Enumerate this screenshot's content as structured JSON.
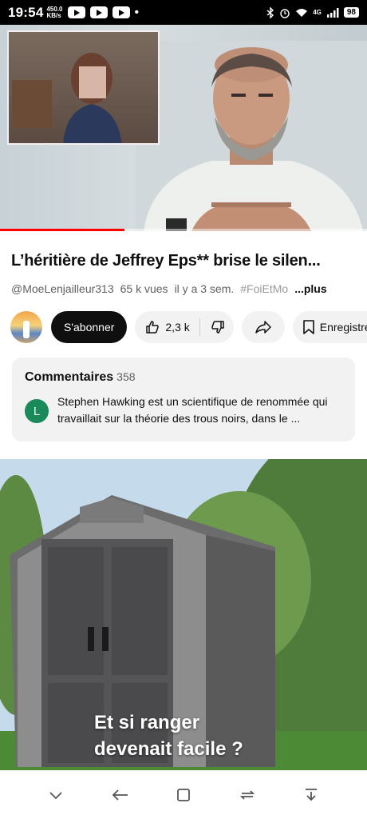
{
  "status_bar": {
    "time": "19:54",
    "speed_value": "450.0",
    "speed_unit": "KB/s",
    "battery": "98",
    "network_label": "4G"
  },
  "video": {
    "progress_fraction": 0.34,
    "progress_color": "#ff0000"
  },
  "info": {
    "title": "L’héritière de Jeffrey Eps** brise le silen...",
    "channel": "@MoeLenjailleur313",
    "views": "65 k vues",
    "age": "il y a 3 sem.",
    "hashtag": "#FoiEtMo",
    "more": "...plus",
    "subscribe_label": "S'abonner",
    "like_count": "2,3 k",
    "save_label": "Enregistrer"
  },
  "comments": {
    "heading": "Commentaires",
    "count": "358",
    "avatar_letter": "L",
    "avatar_color": "#1b8a5a",
    "preview": "Stephen Hawking est un scientifique de renommée qui travaillait sur la théorie des trous noirs, dans le ..."
  },
  "ad": {
    "caption_line1": "Et si ranger",
    "caption_line2": "devenait facile ?"
  },
  "navbar": {
    "icons": [
      "chevron-down-icon",
      "back-icon",
      "home-icon",
      "recents-icon",
      "download-icon"
    ]
  }
}
